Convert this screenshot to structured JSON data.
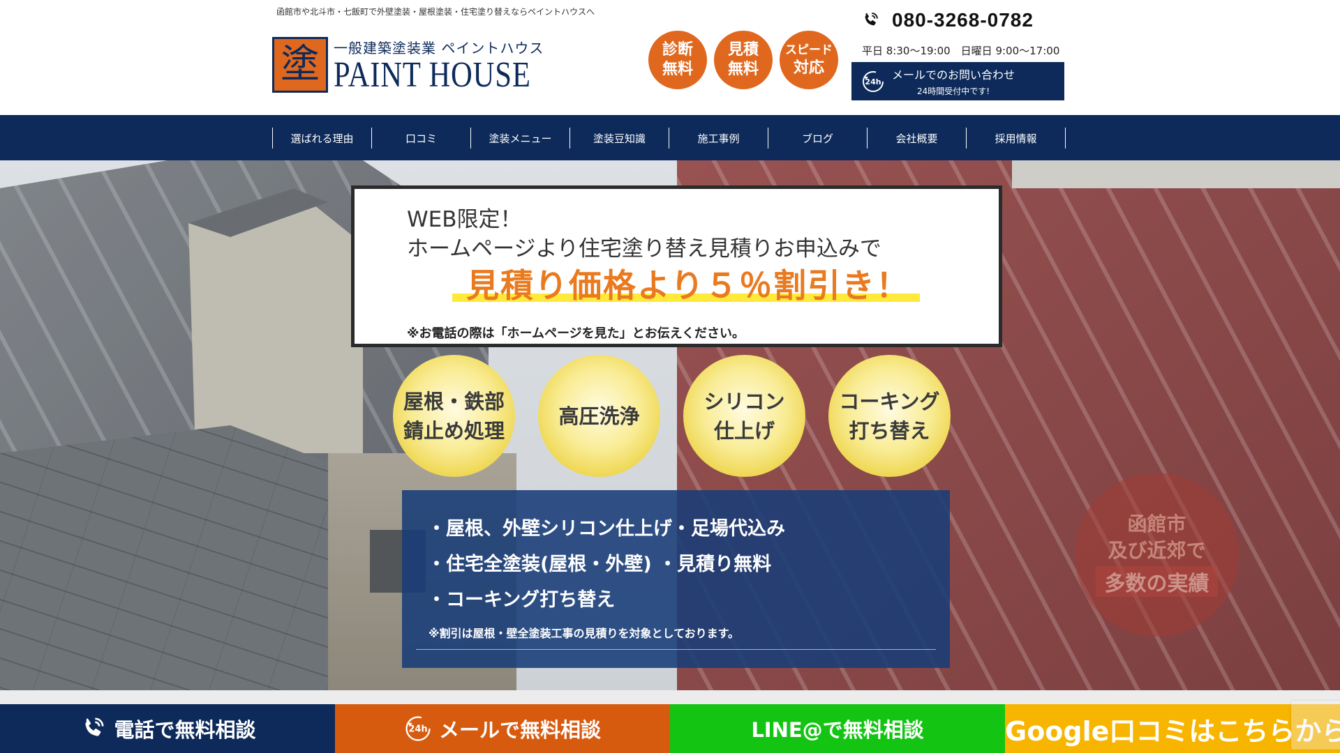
{
  "header": {
    "tagline": "函館市や北斗市・七飯町で外壁塗装・屋根塗装・住宅塗り替えならペイントハウスへ",
    "logo": {
      "mark": "塗",
      "sub": "一般建築塗装業 ペイントハウス",
      "main": "PAINT HOUSE"
    },
    "badges": [
      {
        "line1": "診断",
        "line2": "無料"
      },
      {
        "line1": "見積",
        "line2": "無料"
      },
      {
        "line1": "スピード",
        "line2": "対応"
      }
    ],
    "contact": {
      "phone": "080-3268-0782",
      "hours": "平日 8:30〜19:00　日曜日 9:00〜17:00",
      "mail_label": "メールでのお問い合わせ",
      "mail_sub": "24時間受付中です!",
      "mail_icon_text": "24h"
    }
  },
  "nav": {
    "items": [
      "選ばれる理由",
      "口コミ",
      "塗装メニュー",
      "塗装豆知識",
      "施工事例",
      "ブログ",
      "会社概要",
      "採用情報"
    ]
  },
  "hero": {
    "promo": {
      "line1": "WEB限定！",
      "line2": "ホームページより住宅塗り替え見積りお申込みで",
      "highlight": "見積り価格より５％割引き！",
      "note": "※お電話の際は「ホームページを見た」とお伝えください。"
    },
    "circles": [
      {
        "line1": "屋根・鉄部",
        "line2": "錆止め処理"
      },
      {
        "line1": "高圧洗浄",
        "line2": ""
      },
      {
        "line1": "シリコン",
        "line2": "仕上げ"
      },
      {
        "line1": "コーキング",
        "line2": "打ち替え"
      }
    ],
    "info": {
      "items": [
        "・屋根、外壁シリコン仕上げ・足場代込み",
        "・住宅全塗装(屋根・外壁) ・見積り無料",
        "・コーキング打ち替え"
      ],
      "note": "※割引は屋根・壁全塗装工事の見積りを対象としております。"
    },
    "seal": {
      "line1": "函館市",
      "line2": "及び近郊で",
      "line3": "多数の実績"
    }
  },
  "cta": {
    "phone": "電話で無料相談",
    "mail": "メールで無料相談",
    "mail_icon_text": "24h",
    "line": "LINE@で無料相談",
    "google": "Google口コミはこちらから"
  },
  "colors": {
    "navy": "#0d2a5a",
    "orange": "#e0681e",
    "green": "#13c413",
    "yellow": "#f7b500"
  }
}
